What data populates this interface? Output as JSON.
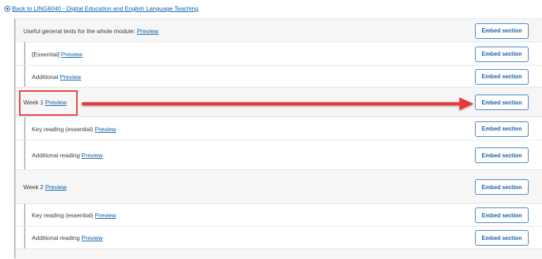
{
  "back_link": {
    "text": "Back to LING6040 - Digital Education and English Language Teaching"
  },
  "embed_label": "Embed section",
  "rows": [
    {
      "prefix": "Useful general texts for the whole module:",
      "link": "Preview"
    },
    {
      "prefix": "[Essential]",
      "link": "Preview"
    },
    {
      "prefix": "Additional",
      "link": "Preview"
    },
    {
      "prefix": "Week 1",
      "link": "Preview"
    },
    {
      "prefix": "Key reading (essential)",
      "link": "Preview"
    },
    {
      "prefix": "Additional reading",
      "link": "Preview"
    },
    {
      "prefix": "Week 2",
      "link": "Preview"
    },
    {
      "prefix": "Key reading (essential)",
      "link": "Preview"
    },
    {
      "prefix": "Additional reading",
      "link": "Preview"
    }
  ],
  "annotation": {
    "color": "#e8393b"
  }
}
